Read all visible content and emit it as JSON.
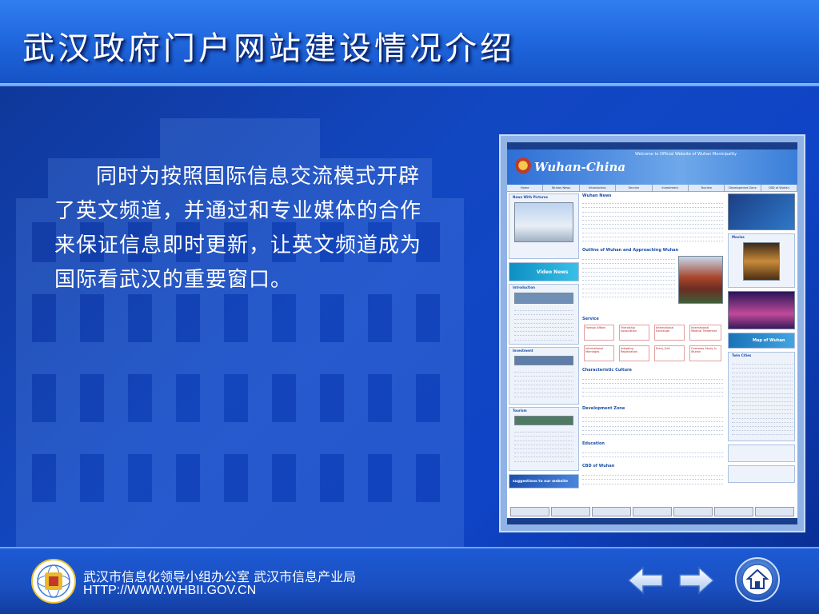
{
  "header": {
    "title": "武汉政府门户网站建设情况介绍"
  },
  "main": {
    "paragraph": "同时为按照国际信息交流模式开辟了英文频道，并通过和专业媒体的合作来保证信息即时更新，让英文频道成为国际看武汉的重要窗口。"
  },
  "screenshot": {
    "site_name": "Wuhan-China",
    "welcome": "Welcome to Official Website of Wuhan Municipality",
    "nav": [
      "Home",
      "Wuhan News",
      "Introduction",
      "Service",
      "Investment",
      "Tourism",
      "Development Zone",
      "CBD of Wuhan"
    ],
    "sections": {
      "news": "Wuhan News",
      "outline": "Outline of Wuhan and Approaching Wuhan",
      "service": "Service",
      "culture": "Characteristic Culture",
      "devzone": "Development Zone",
      "education": "Education",
      "cbd": "CBD of Wuhan",
      "news_pictures": "News With Pictures",
      "introduction": "Introduction",
      "investment": "Investment",
      "tourism": "Tourism",
      "movies": "Movies",
      "twin_cities": "Twin Cities",
      "video_news": "Video News",
      "map": "Map of Wuhan",
      "suggestions": "suggestions to our website"
    },
    "service_cells": [
      "Foreign Affairs",
      "Friendship Association",
      "International Exchange",
      "International Medical Treatment",
      "International Marriages",
      "Adopting Registration",
      "Entry_Exit",
      "Overseas Study in Wuhan"
    ]
  },
  "footer": {
    "org": "武汉市信息化领导小组办公室  武汉市信息产业局",
    "url": "HTTP://WWW.WHBII.GOV.CN"
  },
  "colors": {
    "header_bg": "#1e63da",
    "main_bg": "#1247c2",
    "footer_bg": "#1a4fc0"
  },
  "icons": {
    "prev": "arrow-left-icon",
    "next": "arrow-right-icon",
    "home": "home-icon",
    "logo": "org-emblem-icon"
  }
}
